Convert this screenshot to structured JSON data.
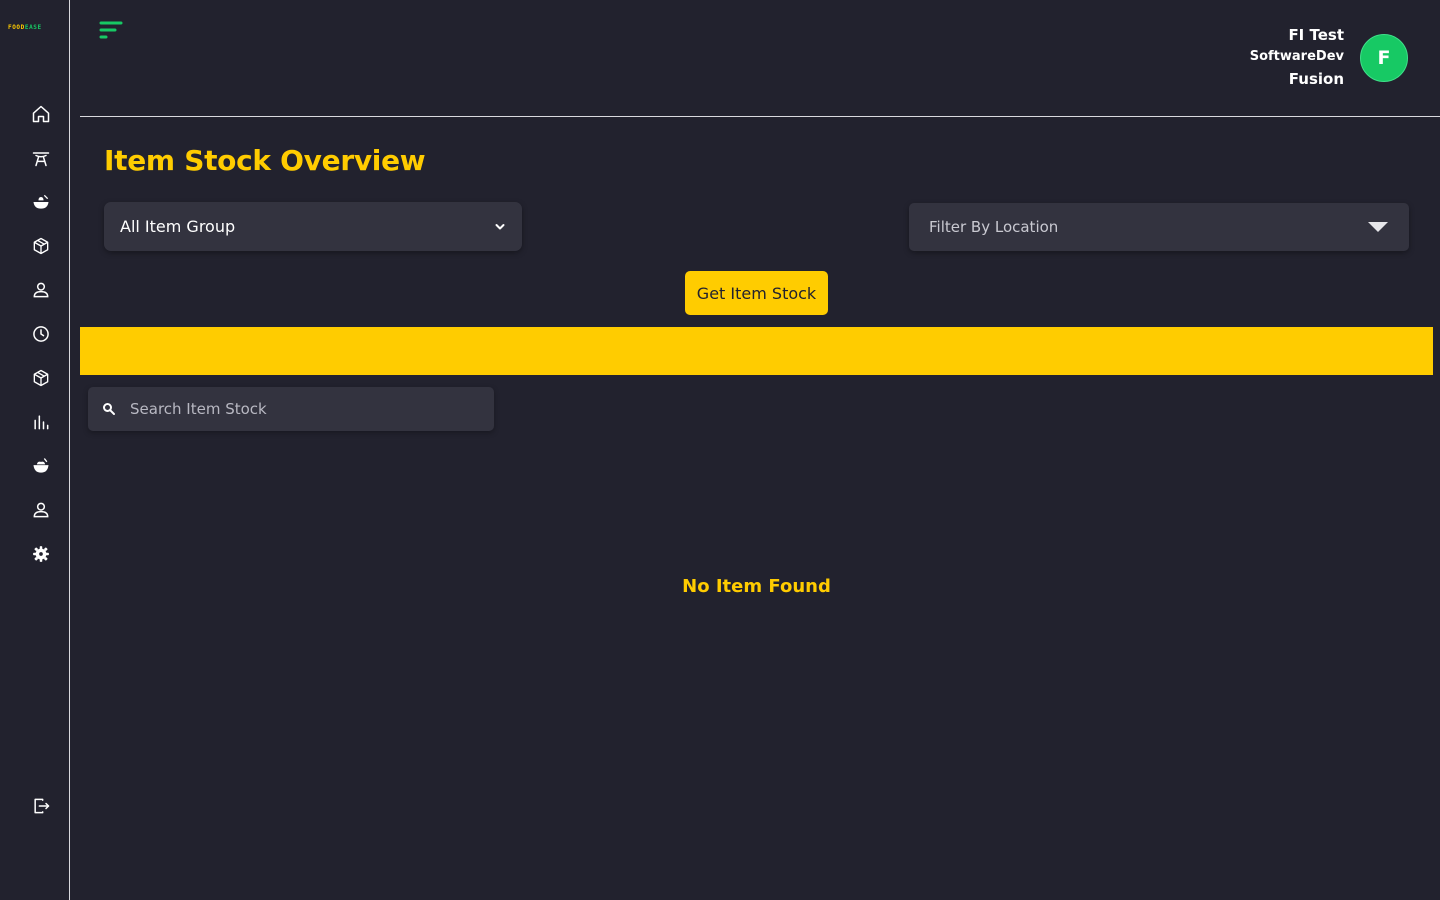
{
  "brand": {
    "logo_part1": "FOOD",
    "logo_part2": "EASE",
    "accent": "#ffcc00",
    "green": "#17c964"
  },
  "sidebar": {
    "items": [
      {
        "name": "home-icon"
      },
      {
        "name": "dining-table-icon"
      },
      {
        "name": "food-bowl-icon"
      },
      {
        "name": "box-icon"
      },
      {
        "name": "user-icon"
      },
      {
        "name": "clock-icon"
      },
      {
        "name": "package-icon"
      },
      {
        "name": "bar-chart-icon"
      },
      {
        "name": "apple-icon"
      },
      {
        "name": "person-icon"
      },
      {
        "name": "gear-icon"
      }
    ],
    "logout": {
      "name": "logout-icon"
    }
  },
  "header": {
    "user_name": "FI Test",
    "user_company": "SoftwareDev",
    "user_org": "Fusion",
    "avatar_letter": "F"
  },
  "main": {
    "title": "Item Stock Overview",
    "group_select_value": "All Item Group",
    "location_placeholder": "Filter By Location",
    "get_button_label": "Get Item Stock",
    "search_placeholder": "Search Item Stock",
    "empty_message": "No Item Found"
  }
}
